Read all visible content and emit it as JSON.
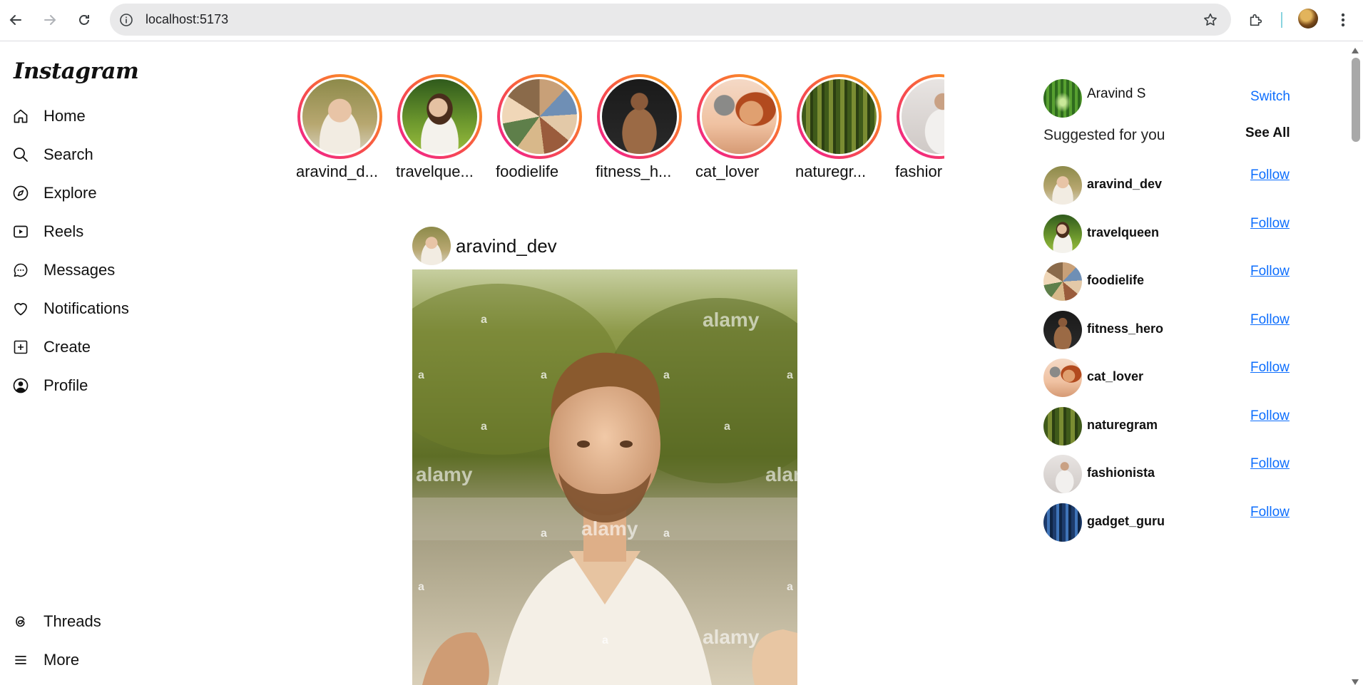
{
  "browser": {
    "url": "localhost:5173",
    "back_icon": "arrow-left-icon",
    "forward_icon": "arrow-right-icon",
    "reload_icon": "reload-icon",
    "info_icon": "info-icon",
    "bookmark_icon": "star-icon",
    "extensions_icon": "puzzle-icon",
    "menu_icon": "kebab-menu-icon"
  },
  "app": {
    "logo": "Instagram"
  },
  "sidebar": {
    "items": [
      {
        "label": "Home",
        "icon": "home-icon"
      },
      {
        "label": "Search",
        "icon": "search-icon"
      },
      {
        "label": "Explore",
        "icon": "compass-icon"
      },
      {
        "label": "Reels",
        "icon": "reels-icon"
      },
      {
        "label": "Messages",
        "icon": "message-icon"
      },
      {
        "label": "Notifications",
        "icon": "heart-icon"
      },
      {
        "label": "Create",
        "icon": "plus-square-icon"
      },
      {
        "label": "Profile",
        "icon": "profile-icon"
      }
    ],
    "bottom_items": [
      {
        "label": "Threads",
        "icon": "threads-icon"
      },
      {
        "label": "More",
        "icon": "hamburger-icon"
      }
    ]
  },
  "stories": [
    {
      "name": "aravind_d..."
    },
    {
      "name": "travelque..."
    },
    {
      "name": "foodielife"
    },
    {
      "name": "fitness_h..."
    },
    {
      "name": "cat_lover"
    },
    {
      "name": "naturegr..."
    },
    {
      "name": "fashior"
    }
  ],
  "post": {
    "username": "aravind_dev",
    "watermark": "alamy",
    "watermark_letter": "a"
  },
  "current_user": {
    "name": "Aravind S",
    "switch_label": "Switch"
  },
  "suggestions": {
    "title": "Suggested for you",
    "see_all_label": "See All",
    "follow_label": "Follow",
    "users": [
      {
        "username": "aravind_dev"
      },
      {
        "username": "travelqueen"
      },
      {
        "username": "foodielife"
      },
      {
        "username": "fitness_hero"
      },
      {
        "username": "cat_lover"
      },
      {
        "username": "naturegram"
      },
      {
        "username": "fashionista"
      },
      {
        "username": "gadget_guru"
      }
    ]
  },
  "colors": {
    "link": "#0d6efd",
    "story_ring_start": "#f0189c",
    "story_ring_end": "#fcaf14"
  }
}
